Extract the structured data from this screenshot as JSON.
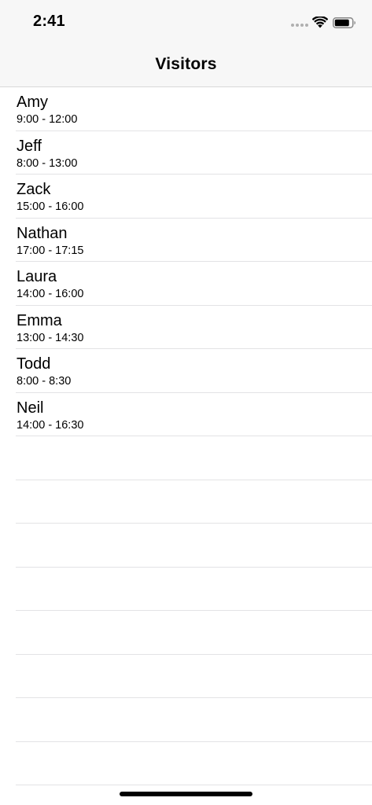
{
  "status_bar": {
    "time": "2:41",
    "icons": [
      "signal-dots-icon",
      "wifi-icon",
      "battery-icon"
    ]
  },
  "nav": {
    "title": "Visitors"
  },
  "visitors": [
    {
      "name": "Amy",
      "time": "9:00 - 12:00"
    },
    {
      "name": "Jeff",
      "time": "8:00 - 13:00"
    },
    {
      "name": "Zack",
      "time": "15:00 - 16:00"
    },
    {
      "name": "Nathan",
      "time": "17:00 - 17:15"
    },
    {
      "name": "Laura",
      "time": "14:00 - 16:00"
    },
    {
      "name": "Emma",
      "time": "13:00 - 14:30"
    },
    {
      "name": "Todd",
      "time": "8:00 - 8:30"
    },
    {
      "name": "Neil",
      "time": "14:00 - 16:30"
    }
  ],
  "colors": {
    "nav_background": "#f7f7f7",
    "separator": "#e3e3e5",
    "text": "#000000"
  }
}
